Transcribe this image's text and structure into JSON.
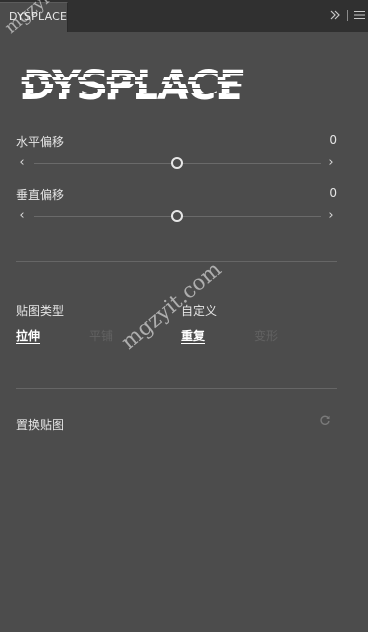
{
  "tab": {
    "title": "DYSPLACE",
    "expand_icon": "double-chevron-right-icon",
    "menu_icon": "hamburger-menu-icon"
  },
  "logo_text": "DYSPLACE",
  "sliders": [
    {
      "label": "水平偏移",
      "value": "0",
      "position": 0.5
    },
    {
      "label": "垂直偏移",
      "value": "0",
      "position": 0.5
    }
  ],
  "slider_arrows": {
    "left": "‹",
    "right": "›"
  },
  "map_type": {
    "label": "贴图类型",
    "options": [
      "拉伸",
      "平铺"
    ],
    "selected": "拉伸"
  },
  "custom": {
    "label": "自定义",
    "options": [
      "重复",
      "变形"
    ],
    "selected": "重复"
  },
  "displacement_map": {
    "label": "置换贴图",
    "refresh_icon": "refresh-icon"
  },
  "watermarks": [
    "mgzyit",
    "mgzyit.com"
  ],
  "colors": {
    "panel_bg": "#4c4c4c",
    "tabbar_bg": "#303030",
    "text": "#e6e6e6",
    "disabled_text": "#626262"
  }
}
